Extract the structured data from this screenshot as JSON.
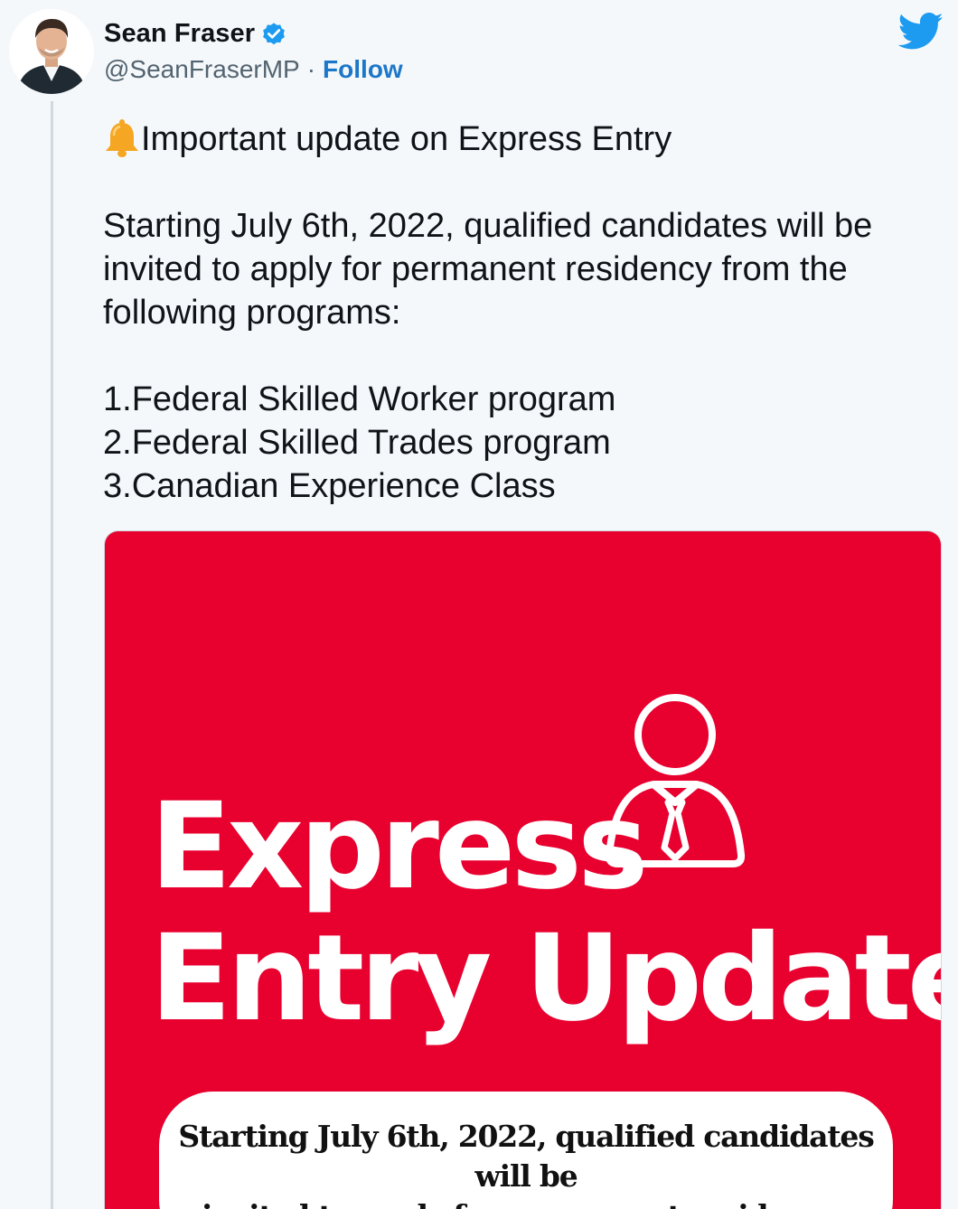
{
  "user": {
    "display_name": "Sean Fraser",
    "handle": "@SeanFraserMP",
    "separator": "·",
    "follow_label": "Follow",
    "verified": true,
    "avatar_icon": "profile-photo"
  },
  "brand": {
    "icon": "twitter-bird-icon",
    "color": "#1d9bf0"
  },
  "tweet": {
    "emoji": "bell-emoji",
    "lines": [
      "Important update on Express Entry",
      "",
      "Starting July 6th, 2022, qualified candidates will be",
      "invited to apply for permanent residency from the",
      "following programs:",
      "",
      "1.Federal Skilled Worker program",
      "2.Federal Skilled Trades program",
      "3.Canadian Experience Class"
    ]
  },
  "media": {
    "background": "#e8002f",
    "headline_line1": "Express",
    "headline_line2": "Entry Update",
    "icon": "businessman-icon",
    "caption_line1": "Starting July 6th, 2022, qualified candidates will be",
    "caption_line2": "invited to apply for permanent residence."
  },
  "colors": {
    "follow": "#1d77c9",
    "handle": "#536471",
    "thread_line": "#cfd9de"
  }
}
